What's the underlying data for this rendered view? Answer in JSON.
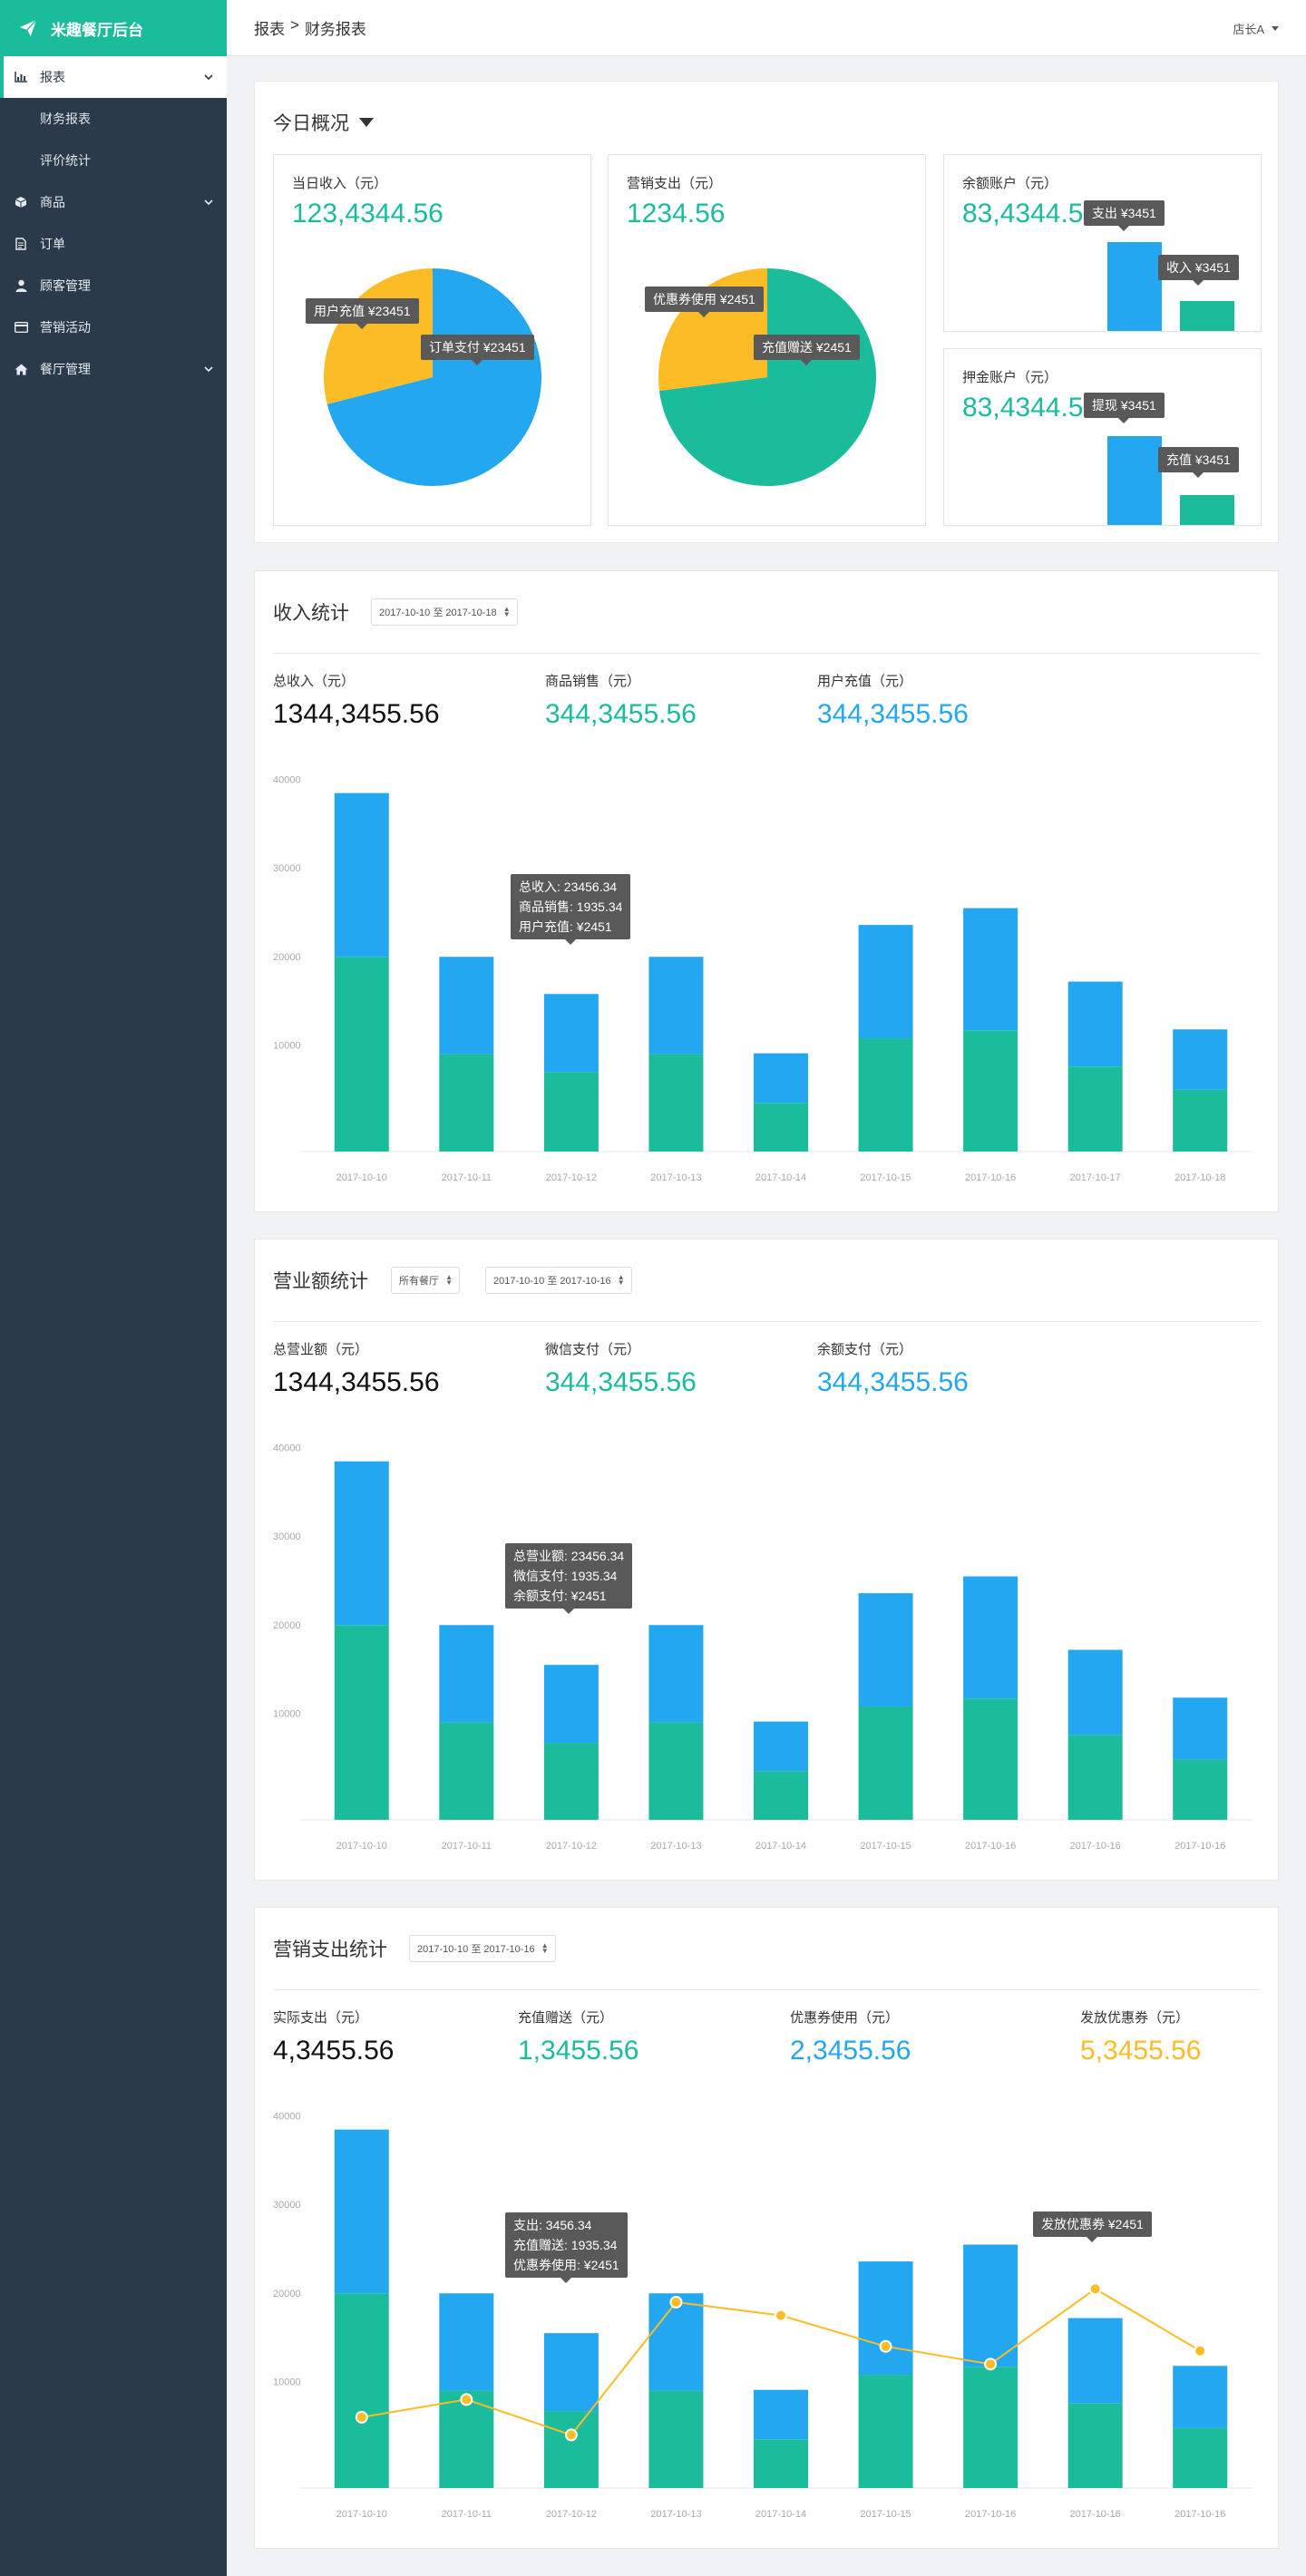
{
  "brand": {
    "title": "米趣餐厅后台"
  },
  "sidebar": {
    "items": [
      {
        "label": "报表",
        "icon": "bar-chart-icon",
        "active": true,
        "children": [
          {
            "label": "财务报表"
          },
          {
            "label": "评价统计"
          }
        ]
      },
      {
        "label": "商品",
        "icon": "cube-icon"
      },
      {
        "label": "订单",
        "icon": "document-icon"
      },
      {
        "label": "顾客管理",
        "icon": "user-icon"
      },
      {
        "label": "营销活动",
        "icon": "card-icon"
      },
      {
        "label": "餐厅管理",
        "icon": "home-icon"
      }
    ]
  },
  "header": {
    "crumb_root": "报表",
    "crumb_sep": ">",
    "crumb_current": "财务报表",
    "user": "店长A"
  },
  "today": {
    "title": "今日概况",
    "income": {
      "label": "当日收入（元）",
      "value": "123,4344.56",
      "tip_a": "用户充值 ¥23451",
      "tip_b": "订单支付 ¥23451"
    },
    "marketing": {
      "label": "营销支出（元）",
      "value": "1234.56",
      "tip_a": "优惠券使用 ¥2451",
      "tip_b": "充值赠送 ¥2451"
    },
    "balance": {
      "label": "余额账户（元）",
      "value": "83,4344.56",
      "tip_a": "支出 ¥3451",
      "tip_b": "收入 ¥3451"
    },
    "deposit": {
      "label": "押金账户（元）",
      "value": "83,4344.56",
      "tip_a": "提现 ¥3451",
      "tip_b": "充值 ¥3451"
    }
  },
  "income_stats": {
    "title": "收入统计",
    "range": "2017-10-10 至 2017-10-18",
    "stats": [
      {
        "label": "总收入（元）",
        "value": "1344,3455.56"
      },
      {
        "label": "商品销售（元）",
        "value": "344,3455.56"
      },
      {
        "label": "用户充值（元）",
        "value": "344,3455.56"
      }
    ],
    "tip": [
      "总收入: 23456.34",
      "商品销售: 1935.34",
      "用户充值: ¥2451"
    ]
  },
  "revenue_stats": {
    "title": "营业额统计",
    "store": "所有餐厅",
    "range": "2017-10-10 至 2017-10-16",
    "stats": [
      {
        "label": "总营业额（元）",
        "value": "1344,3455.56"
      },
      {
        "label": "微信支付（元）",
        "value": "344,3455.56"
      },
      {
        "label": "余额支付（元）",
        "value": "344,3455.56"
      }
    ],
    "tip": [
      "总营业额: 23456.34",
      "微信支付: 1935.34",
      "余额支付: ¥2451"
    ]
  },
  "marketing_stats": {
    "title": "营销支出统计",
    "range": "2017-10-10 至 2017-10-16",
    "stats": [
      {
        "label": "实际支出（元）",
        "value": "4,3455.56"
      },
      {
        "label": "充值赠送（元）",
        "value": "1,3455.56"
      },
      {
        "label": "优惠券使用（元）",
        "value": "2,3455.56"
      },
      {
        "label": "发放优惠券（元）",
        "value": "5,3455.56"
      }
    ],
    "tip": [
      "支出: 3456.34",
      "充值赠送: 1935.34",
      "优惠券使用: ¥2451"
    ],
    "tip2": "发放优惠券 ¥2451"
  },
  "colors": {
    "green": "#1abc9c",
    "blue": "#22a7f0",
    "yellow": "#fbbc25",
    "sidebar": "#2b3a4b"
  },
  "chart_data": [
    {
      "type": "pie",
      "categories": [
        "订单支付",
        "用户充值"
      ],
      "values": [
        71,
        29
      ]
    },
    {
      "type": "pie",
      "categories": [
        "充值赠送",
        "优惠券使用"
      ],
      "values": [
        73,
        27
      ]
    },
    {
      "type": "bar",
      "categories": [
        "支出",
        "收入"
      ],
      "values": [
        2,
        0.7
      ]
    },
    {
      "type": "bar",
      "categories": [
        "提现",
        "充值"
      ],
      "values": [
        2,
        0.7
      ]
    },
    {
      "type": "bar",
      "stacked": true,
      "categories": [
        "2017-10-10",
        "2017-10-11",
        "2017-10-12",
        "2017-10-13",
        "2017-10-14",
        "2017-10-15",
        "2017-10-16",
        "2017-10-17",
        "2017-10-18"
      ],
      "series": [
        {
          "color": "green",
          "values": [
            22000,
            11000,
            9000,
            11000,
            5500,
            12800,
            13700,
            9600,
            7000
          ]
        },
        {
          "color": "blue",
          "values": [
            18500,
            11000,
            8800,
            11000,
            5600,
            12800,
            13800,
            9600,
            6800
          ]
        }
      ],
      "yticks": [
        10000,
        20000,
        30000,
        40000
      ],
      "ylim": [
        0,
        42000
      ],
      "grid": false
    },
    {
      "type": "bar",
      "stacked": true,
      "categories": [
        "2017-10-10",
        "2017-10-11",
        "2017-10-12",
        "2017-10-13",
        "2017-10-14",
        "2017-10-15",
        "2017-10-16",
        "2017-10-16",
        "2017-10-16"
      ],
      "series": [
        {
          "color": "green",
          "values": [
            22000,
            11000,
            8700,
            11000,
            5500,
            12800,
            13700,
            9600,
            6800
          ]
        },
        {
          "color": "blue",
          "values": [
            18500,
            11000,
            8800,
            11000,
            5600,
            12800,
            13800,
            9600,
            7000
          ]
        }
      ],
      "yticks": [
        10000,
        20000,
        30000,
        40000
      ],
      "ylim": [
        0,
        42000
      ],
      "grid": false
    },
    {
      "type": "bar",
      "stacked": true,
      "categories": [
        "2017-10-10",
        "2017-10-11",
        "2017-10-12",
        "2017-10-13",
        "2017-10-14",
        "2017-10-15",
        "2017-10-16",
        "2017-10-16",
        "2017-10-16"
      ],
      "series": [
        {
          "color": "green",
          "values": [
            22000,
            11000,
            8700,
            11000,
            5500,
            12800,
            13700,
            9600,
            6800
          ]
        },
        {
          "color": "blue",
          "values": [
            18500,
            11000,
            8800,
            11000,
            5600,
            12800,
            13800,
            9600,
            7000
          ]
        }
      ],
      "line": {
        "color": "yellow",
        "values": [
          8000,
          10000,
          6000,
          21000,
          19500,
          16000,
          14000,
          22500,
          15500
        ]
      },
      "yticks": [
        10000,
        20000,
        30000,
        40000
      ],
      "ylim": [
        0,
        42000
      ],
      "grid": false
    }
  ]
}
